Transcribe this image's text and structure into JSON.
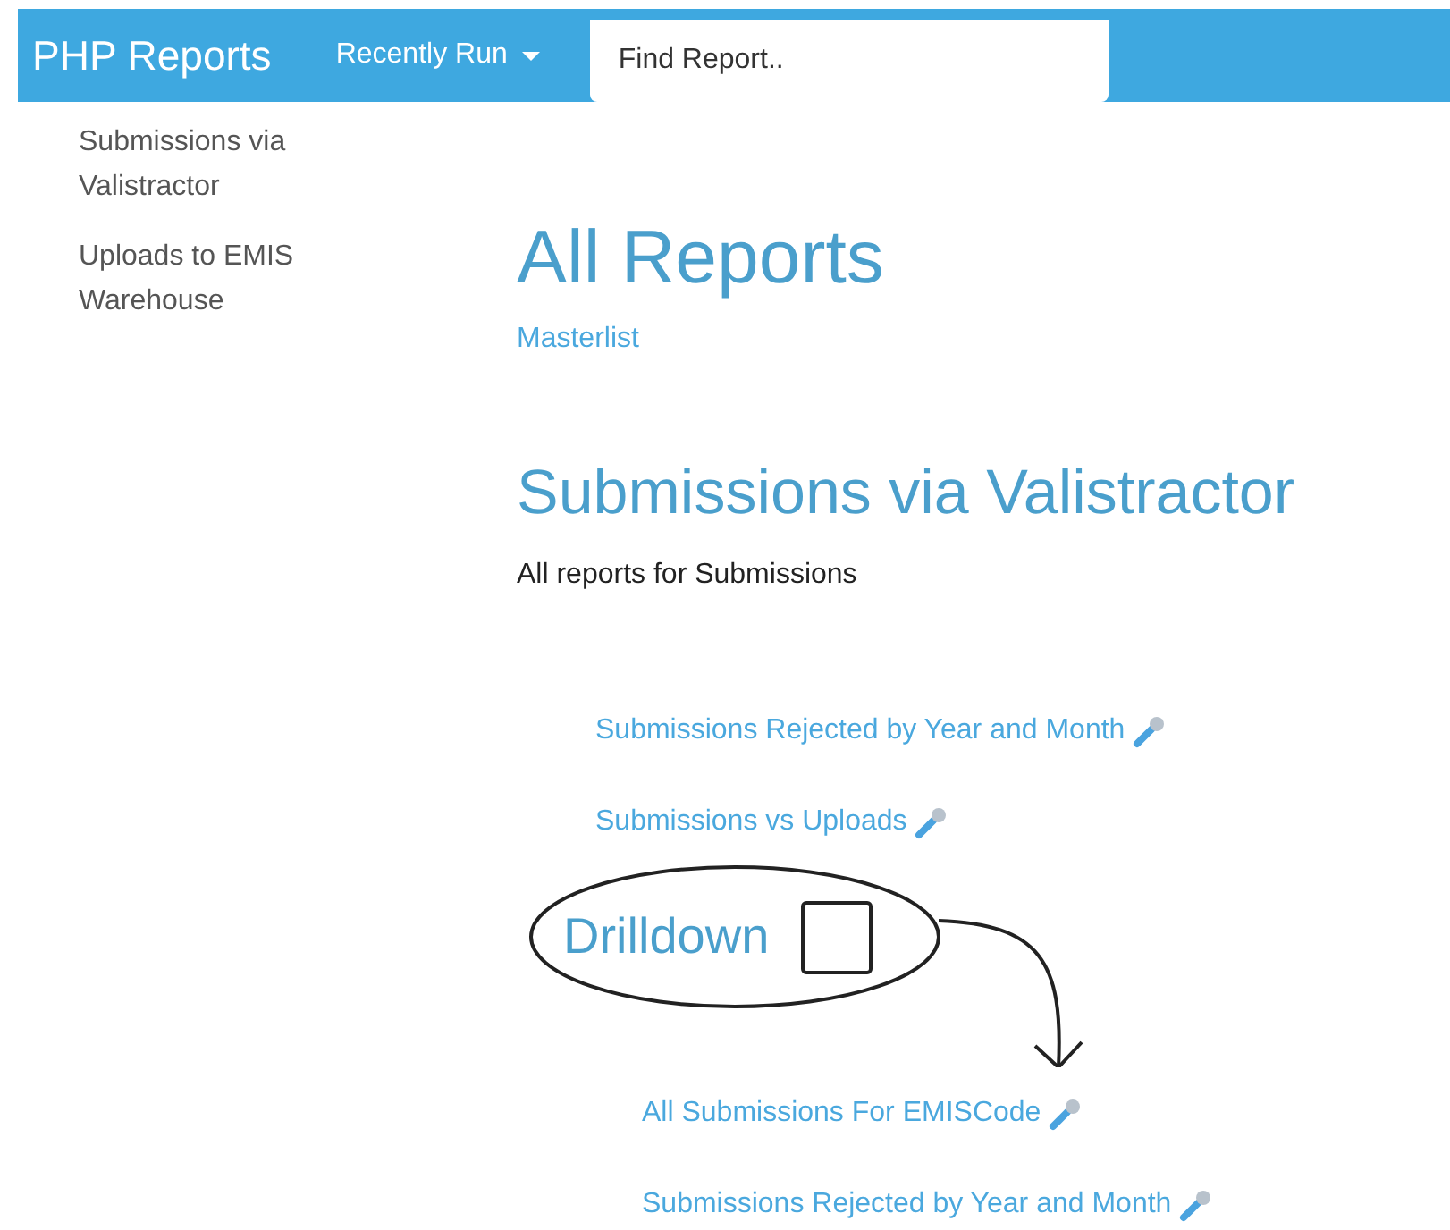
{
  "navbar": {
    "brand": "PHP Reports",
    "menu": "Recently Run",
    "search": {
      "placeholder": "Find Report.."
    }
  },
  "sidebar": {
    "items": [
      "Submissions via Valistractor",
      "Uploads to EMIS Warehouse"
    ]
  },
  "main": {
    "title": "All Reports",
    "links": [
      "Masterlist"
    ],
    "sections": [
      {
        "title": "Submissions via Valistractor",
        "description": "All reports for Submissions",
        "reports": [
          "Submissions Rejected by Year and Month",
          "Submissions vs Uploads"
        ],
        "subsections": [
          {
            "title": "Drilldown",
            "reports": [
              "All Submissions For EMISCode",
              "Submissions Rejected by Year and Month"
            ]
          }
        ]
      }
    ]
  }
}
